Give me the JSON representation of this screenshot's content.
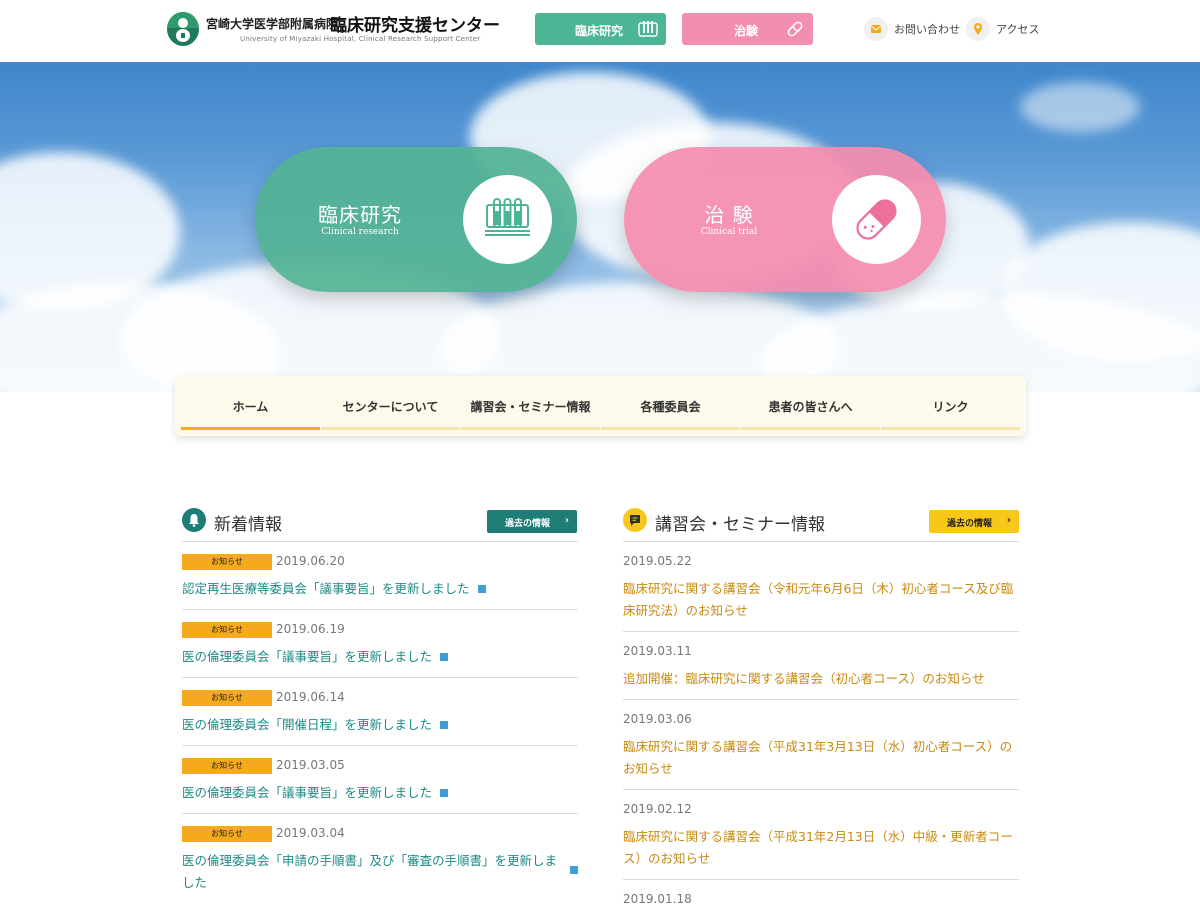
{
  "header": {
    "org_name": "宮崎大学医学部附属病院",
    "center_name": "臨床研究支援センター",
    "org_en": "University of Miyazaki Hospital, Clinical Research Support Center",
    "btn_research": "臨床研究",
    "btn_trial": "治験",
    "contact": "お問い合わせ",
    "access": "アクセス"
  },
  "hero": {
    "research_jp": "臨床研究",
    "research_en": "Clinical research",
    "trial_jp": "治 験",
    "trial_en": "Clinical trial"
  },
  "nav": {
    "items": [
      {
        "label": "ホーム"
      },
      {
        "label": "センターについて"
      },
      {
        "label": "講習会・セミナー情報"
      },
      {
        "label": "各種委員会"
      },
      {
        "label": "患者の皆さんへ"
      },
      {
        "label": "リンク"
      }
    ]
  },
  "news": {
    "title": "新着情報",
    "more": "過去の情報",
    "items": [
      {
        "badge": "お知らせ",
        "date": "2019.06.20",
        "text": "認定再生医療等委員会「議事要旨」を更新しました"
      },
      {
        "badge": "お知らせ",
        "date": "2019.06.19",
        "text": "医の倫理委員会「議事要旨」を更新しました"
      },
      {
        "badge": "お知らせ",
        "date": "2019.06.14",
        "text": "医の倫理委員会「開催日程」を更新しました"
      },
      {
        "badge": "お知らせ",
        "date": "2019.03.05",
        "text": "医の倫理委員会「議事要旨」を更新しました"
      },
      {
        "badge": "お知らせ",
        "date": "2019.03.04",
        "text": "医の倫理委員会「申請の手順書」及び「審査の手順書」を更新しました"
      }
    ]
  },
  "seminar": {
    "title": "講習会・セミナー情報",
    "more": "過去の情報",
    "items": [
      {
        "date": "2019.05.22",
        "text": "臨床研究に関する講習会（令和元年6月6日（木）初心者コース及び臨床研究法）のお知らせ"
      },
      {
        "date": "2019.03.11",
        "text": "追加開催：臨床研究に関する講習会（初心者コース）のお知らせ"
      },
      {
        "date": "2019.03.06",
        "text": "臨床研究に関する講習会（平成31年3月13日（水）初心者コース）のお知らせ"
      },
      {
        "date": "2019.02.12",
        "text": "臨床研究に関する講習会（平成31年2月13日（水）中級・更新者コース）のお知らせ"
      },
      {
        "date": "2019.01.18",
        "text": ""
      }
    ]
  },
  "colors": {
    "green": "#4cb596",
    "pink": "#f28eb1",
    "orange": "#f5a91c",
    "teal_link": "#1d8a86",
    "gold_link": "#c98a10",
    "dark_teal_button": "#1f7d77",
    "yellow_button": "#f7c81a"
  },
  "icons": {
    "research": "test-tubes-icon",
    "trial": "pill-icon",
    "contact": "mail-icon",
    "access": "map-pin-icon",
    "news": "bell-icon",
    "seminar": "speech-bubble-icon",
    "external": "external-link-icon"
  }
}
